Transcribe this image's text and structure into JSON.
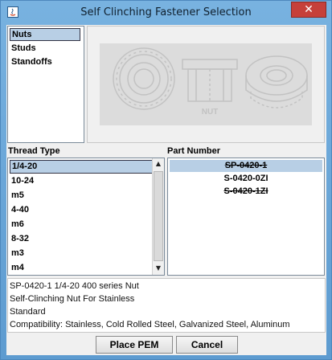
{
  "window": {
    "title": "Self Clinching Fastener Selection",
    "close_glyph": "✕",
    "accent_color": "#6fa8d8",
    "close_color": "#c6403a"
  },
  "fastener_types": {
    "items": [
      "Nuts",
      "Studs",
      "Standoffs"
    ],
    "selected_index": 0
  },
  "preview": {
    "image_label": "NUT",
    "icons": [
      "nut-top-view-drawing",
      "nut-side-view-drawing",
      "nut-perspective-drawing"
    ]
  },
  "thread_type": {
    "label": "Thread Type",
    "items": [
      "1/4-20",
      "10-24",
      "m5",
      "4-40",
      "m6",
      "8-32",
      "m3",
      "m4"
    ],
    "selected_index": 0,
    "scroll_up_glyph": "▲",
    "scroll_down_glyph": "▼"
  },
  "part_number": {
    "label": "Part Number",
    "items": [
      {
        "text": "SP-0420-1",
        "strikethrough": true,
        "selected": true
      },
      {
        "text": "S-0420-0ZI",
        "strikethrough": false,
        "selected": false
      },
      {
        "text": "S-0420-1ZI",
        "strikethrough": true,
        "selected": false
      }
    ]
  },
  "description": {
    "lines": [
      "SP-0420-1 1/4-20 400 series Nut",
      "Self-Clinching Nut For Stainless",
      "Standard",
      "Compatibility: Stainless, Cold Rolled Steel, Galvanized Steel,  Aluminum"
    ]
  },
  "buttons": {
    "place": "Place PEM",
    "cancel": "Cancel"
  }
}
